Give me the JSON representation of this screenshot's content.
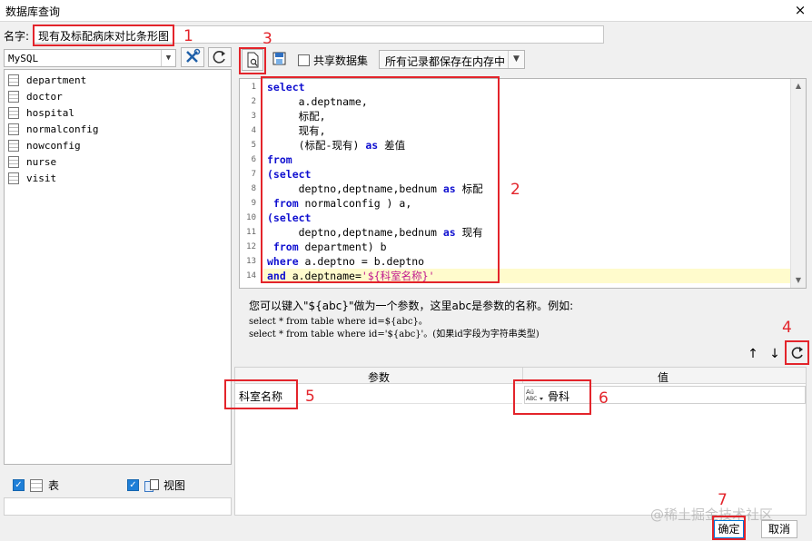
{
  "window": {
    "title": "数据库查询",
    "close": "×"
  },
  "name_field": {
    "label": "名字:",
    "value": "现有及标配病床对比条形图"
  },
  "left": {
    "db_type": "MySQL",
    "tables": [
      "department",
      "doctor",
      "hospital",
      "normalconfig",
      "nowconfig",
      "nurse",
      "visit"
    ],
    "show_tables_label": "表",
    "show_views_label": "视图"
  },
  "toolbar": {
    "share_label": "共享数据集",
    "memory_option": "所有记录都保存在内存中"
  },
  "editor": {
    "line_numbers": [
      "1",
      "2",
      "3",
      "4",
      "5",
      "6",
      "7",
      "8",
      "9",
      "10",
      "11",
      "12",
      "13",
      "14"
    ],
    "lines": [
      {
        "kw": "select",
        "rest": ""
      },
      {
        "kw": "",
        "rest": "     a.deptname,"
      },
      {
        "kw": "",
        "rest": "     标配,"
      },
      {
        "kw": "",
        "rest": "     现有,"
      },
      {
        "kw": "",
        "rest": "     (标配-现有) ",
        "kw2": "as",
        "rest2": " 差值"
      },
      {
        "kw": "from",
        "rest": ""
      },
      {
        "kw": "(select",
        "rest": ""
      },
      {
        "kw": "",
        "rest": "     deptno,deptname,bednum ",
        "kw2": "as",
        "rest2": " 标配"
      },
      {
        "kw": " from",
        "rest": " normalconfig ) a,"
      },
      {
        "kw": "(select",
        "rest": ""
      },
      {
        "kw": "",
        "rest": "     deptno,deptname,bednum ",
        "kw2": "as",
        "rest2": " 现有"
      },
      {
        "kw": " from",
        "rest": " department) b"
      },
      {
        "kw": "where",
        "rest": " a.deptno = b.deptno"
      },
      {
        "kw": "and",
        "rest": " a.deptname=",
        "str": "'${科室名称}'"
      }
    ]
  },
  "hint": {
    "line1": "您可以键入\"${abc}\"做为一个参数，这里abc是参数的名称。例如:",
    "line2": "select * from table where id=${abc}。",
    "line3": "select * from table where id='${abc}'。(如果id字段为字符串类型)"
  },
  "params": {
    "col_param": "参数",
    "col_value": "值",
    "rows": [
      {
        "name": "科室名称",
        "value": "骨科",
        "type_icon": "abc-type-icon"
      }
    ]
  },
  "buttons": {
    "ok": "确定",
    "cancel": "取消"
  },
  "annotations": [
    "1",
    "2",
    "3",
    "4",
    "5",
    "6",
    "7"
  ],
  "watermark": "@稀土掘金技术社区",
  "colors": {
    "annotation_red": "#e3242b",
    "keyword_blue": "#1010d0",
    "string_magenta": "#c0168d",
    "checkbox_blue": "#1e7fd8",
    "current_line": "#fffbcc"
  }
}
